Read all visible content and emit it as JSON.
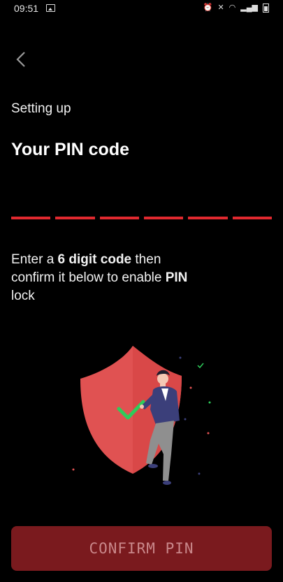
{
  "status_bar": {
    "time": "09:51",
    "icons": [
      "image-icon",
      "alarm-icon",
      "mute-icon",
      "wifi-icon",
      "signal-icon",
      "battery-icon"
    ]
  },
  "header": {
    "back_icon": "chevron-left-icon",
    "subtitle": "Setting up",
    "title": "Your PIN code"
  },
  "pin": {
    "digits": 6,
    "slot_color": "#e0292f"
  },
  "instructions": {
    "part1": "Enter a ",
    "bold1": "6 digit code",
    "part2": " then confirm it below to enable ",
    "bold2": "PIN",
    "part3": " lock"
  },
  "illustration": {
    "name": "security-shield-illustration",
    "shield_color": "#e05252"
  },
  "confirm_button": {
    "label": "CONFIRM PIN",
    "background": "#7a1a1e"
  }
}
